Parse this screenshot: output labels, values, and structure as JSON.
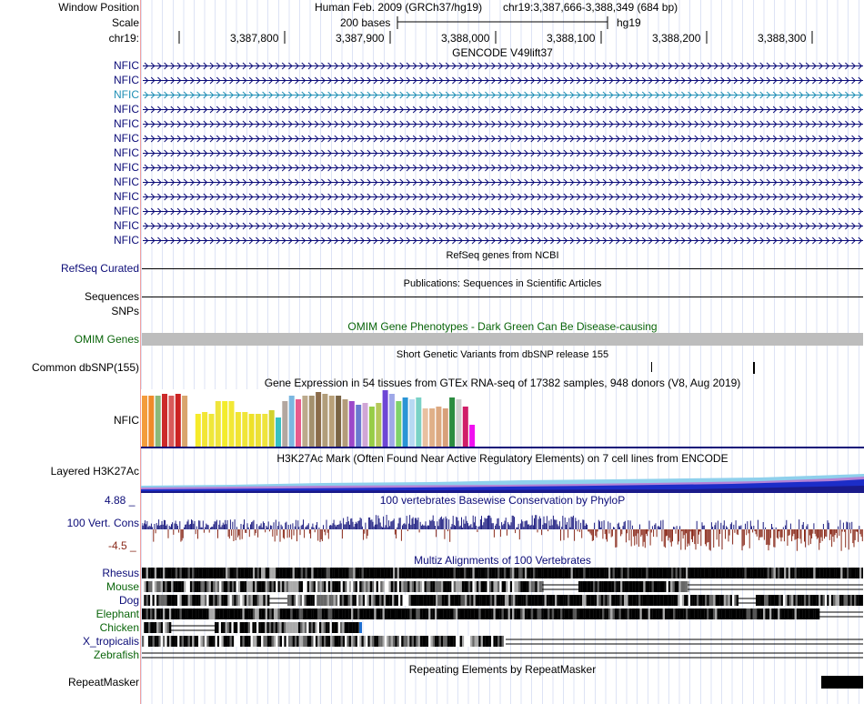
{
  "header": {
    "window_position_label": "Window Position",
    "scale_label": "Scale",
    "chrom_label": "chr19:",
    "assembly": "Human Feb. 2009 (GRCh37/hg19)",
    "position": "chr19:3,387,666-3,388,349 (684 bp)",
    "scale_text": "200 bases",
    "db": "hg19",
    "ticks": [
      "3,387,800",
      "3,387,900",
      "3,388,000",
      "3,388,100",
      "3,388,200",
      "3,388,300"
    ]
  },
  "gencode": {
    "title": "GENCODE V49lift37",
    "genes": [
      "NFIC",
      "NFIC",
      "NFIC",
      "NFIC",
      "NFIC",
      "NFIC",
      "NFIC",
      "NFIC",
      "NFIC",
      "NFIC",
      "NFIC",
      "NFIC",
      "NFIC"
    ],
    "highlight_index": 2,
    "gene_color": "#0c0c78",
    "highlight_color": "#1f8fb5"
  },
  "refseq": {
    "title": "RefSeq genes from NCBI",
    "label": "RefSeq Curated"
  },
  "publications": {
    "title": "Publications: Sequences in Scientific Articles",
    "label": "Sequences",
    "snps_label": "SNPs"
  },
  "omim": {
    "title": "OMIM Gene Phenotypes - Dark Green Can Be Disease-causing",
    "label": "OMIM Genes",
    "color": "#0a650a"
  },
  "dbsnp": {
    "title": "Short Genetic Variants from dbSNP release 155",
    "label": "Common dbSNP(155)"
  },
  "gtex": {
    "title": "Gene Expression in 54 tissues from GTEx RNA-seq of 17382 samples, 948 donors (V8, Aug 2019)",
    "label": "NFIC"
  },
  "h3k27ac": {
    "title": "H3K27Ac Mark (Often Found Near Active Regulatory Elements) on 7 cell lines from ENCODE",
    "label": "Layered H3K27Ac"
  },
  "phylop": {
    "title": "100 vertebrates Basewise Conservation by PhyloP",
    "label": "100 Vert. Cons",
    "max": "4.88 _",
    "min": "-4.5 _",
    "pos_color": "#1f1f82",
    "neg_color": "#8a2a1a"
  },
  "multiz": {
    "title": "Multiz Alignments of 100 Vertebrates",
    "species": [
      "Rhesus",
      "Mouse",
      "Dog",
      "Elephant",
      "Chicken",
      "X_tropicalis",
      "Zebrafish"
    ]
  },
  "repeatmasker": {
    "title": "Repeating Elements by RepeatMasker",
    "label": "RepeatMasker"
  }
}
